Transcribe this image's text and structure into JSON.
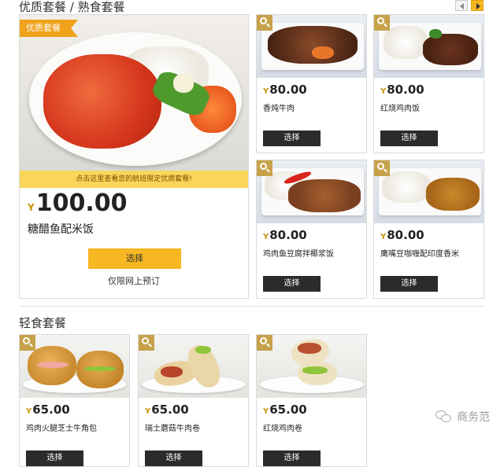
{
  "top_section": {
    "title": "优质套餐 / 熟食套餐"
  },
  "pager": {
    "prev_icon": "triangle-left-icon",
    "next_icon": "triangle-right-icon"
  },
  "featured": {
    "tag": "优质套餐",
    "promo": "点击这里查看您的航班限定优质套餐!",
    "currency": "Y",
    "price": "100.00",
    "name": "糖醋鱼配米饭",
    "button": "选择",
    "note": "仅限网上预订"
  },
  "top_items": [
    {
      "currency": "Y",
      "price": "80.00",
      "name": "香炖牛肉",
      "button": "选择"
    },
    {
      "currency": "Y",
      "price": "80.00",
      "name": "红烧鸡肉饭",
      "button": "选择"
    },
    {
      "currency": "Y",
      "price": "80.00",
      "name": "鸡肉鱼豆腐拌椰浆饭",
      "button": "选择"
    },
    {
      "currency": "Y",
      "price": "80.00",
      "name": "鹰嘴豆咖喱配印度香米",
      "button": "选择"
    }
  ],
  "light_section": {
    "title": "轻食套餐"
  },
  "light_items": [
    {
      "currency": "Y",
      "price": "65.00",
      "name": "鸡肉火腿芝士牛角包",
      "button": "选择"
    },
    {
      "currency": "Y",
      "price": "65.00",
      "name": "瑞士蘑菇牛肉卷",
      "button": "选择"
    },
    {
      "currency": "Y",
      "price": "65.00",
      "name": "红烧鸡肉卷",
      "button": "选择"
    }
  ],
  "watermark": {
    "text": "商务范"
  },
  "colors": {
    "accent": "#f6b722",
    "button_dark": "#2b2b2b",
    "tag_orange": "#f0a21a",
    "promo_yellow": "#f9d65a"
  }
}
